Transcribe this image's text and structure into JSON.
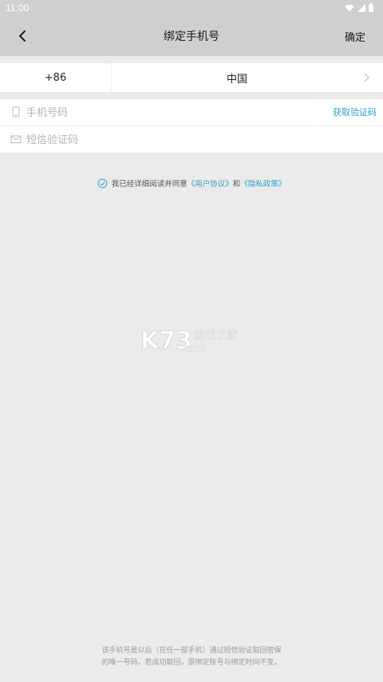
{
  "status_bar": {
    "time": "11:00"
  },
  "header": {
    "title": "绑定手机号",
    "confirm_label": "确定"
  },
  "country": {
    "code": "+86",
    "name": "中国"
  },
  "form": {
    "phone_placeholder": "手机号码",
    "code_placeholder": "短信验证码",
    "get_code_label": "获取验证码"
  },
  "agreement": {
    "text": "我已经详细阅读并同意",
    "user_agreement": "《用户协议》",
    "and": "和",
    "privacy_policy": "《隐私政策》"
  },
  "watermark": {
    "text": "K73游戏之家 .com"
  },
  "footer": {
    "line1": "该手机号是以后（在任一部手机）通过短信验证取回密保",
    "line2": "的唯一号码，若成功取回，原绑定账号与绑定时间不变。"
  },
  "colors": {
    "accent": "#2aa3c8",
    "header_bg": "#cfcfcf",
    "page_bg": "#ebebeb"
  },
  "icons": {
    "back": "chevron-left-icon",
    "phone": "phone-icon",
    "message": "envelope-icon",
    "check": "check-circle-icon",
    "arrow": "chevron-right-icon"
  }
}
